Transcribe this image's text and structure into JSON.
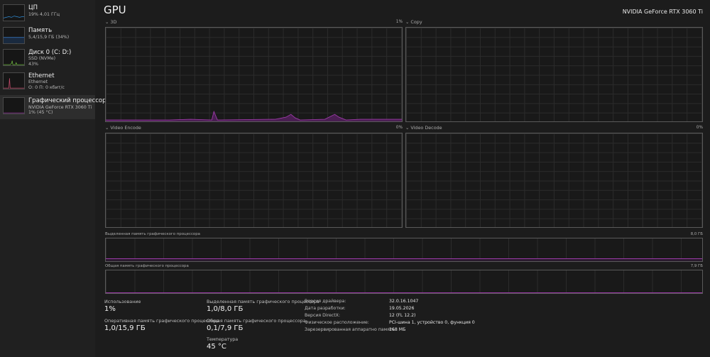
{
  "sidebar": {
    "items": [
      {
        "title": "ЦП",
        "lines": [
          "19% 4,01 ГГц"
        ],
        "color": "#2f8dd6",
        "selected": false
      },
      {
        "title": "Память",
        "lines": [
          "5,4/15,9 ГБ (34%)"
        ],
        "color": "#3b7fd0",
        "selected": false
      },
      {
        "title": "Диск 0 (C: D:)",
        "lines": [
          "SSD (NVMe)",
          "43%"
        ],
        "color": "#6fb63f",
        "selected": false
      },
      {
        "title": "Ethernet",
        "lines": [
          "Ethernet",
          "О: 0 П: 0 кбит/с"
        ],
        "color": "#c24a6a",
        "selected": false
      },
      {
        "title": "Графический процессор",
        "lines": [
          "NVIDIA GeForce RTX 3060 Ti",
          "1% (45 °C)"
        ],
        "color": "#9b3aa6",
        "selected": true
      }
    ]
  },
  "header": {
    "title": "GPU",
    "device": "NVIDIA GeForce RTX 3060 Ti"
  },
  "graphs": {
    "g3d": {
      "label": "3D",
      "percent": "1%"
    },
    "copy": {
      "label": "Copy",
      "percent": "0%"
    },
    "video_encode": {
      "label": "Video Encode",
      "percent": "0%"
    },
    "video_decode": {
      "label": "Video Decode",
      "percent": "0%"
    },
    "dedicated_memory": {
      "label": "Выделенная память графического процессора",
      "max": "8,0 ГБ"
    },
    "shared_memory": {
      "label": "Общая память графического процессора",
      "max": "7,9 ГБ"
    }
  },
  "stats": {
    "usage_label": "Использование",
    "usage_value": "1%",
    "ram_label": "Оперативная память графического процессора",
    "ram_value": "1,0/15,9 ГБ",
    "dedicated_label": "Выделенная память графического процессора",
    "dedicated_value": "1,0/8,0 ГБ",
    "shared_label": "Общая память графического процессора",
    "shared_value": "0,1/7,9 ГБ",
    "temp_label": "Температура",
    "temp_value": "45 °C"
  },
  "info": {
    "driver_version_label": "Версия драйвера:",
    "driver_version": "32.0.16.1047",
    "driver_date_label": "Дата разработки:",
    "driver_date": "19.05.2026",
    "directx_label": "Версия DirectX:",
    "directx": "12 (FL 12.2)",
    "location_label": "Физическое расположение:",
    "location": "PCI-шина 1, устройство 0, функция 0",
    "reserved_label": "Зарезервированная аппаратно память:",
    "reserved": "168 МБ"
  },
  "colors": {
    "accent_gpu": "#9b3aa6",
    "background": "#1c1c1c",
    "sidebar": "#202020"
  }
}
